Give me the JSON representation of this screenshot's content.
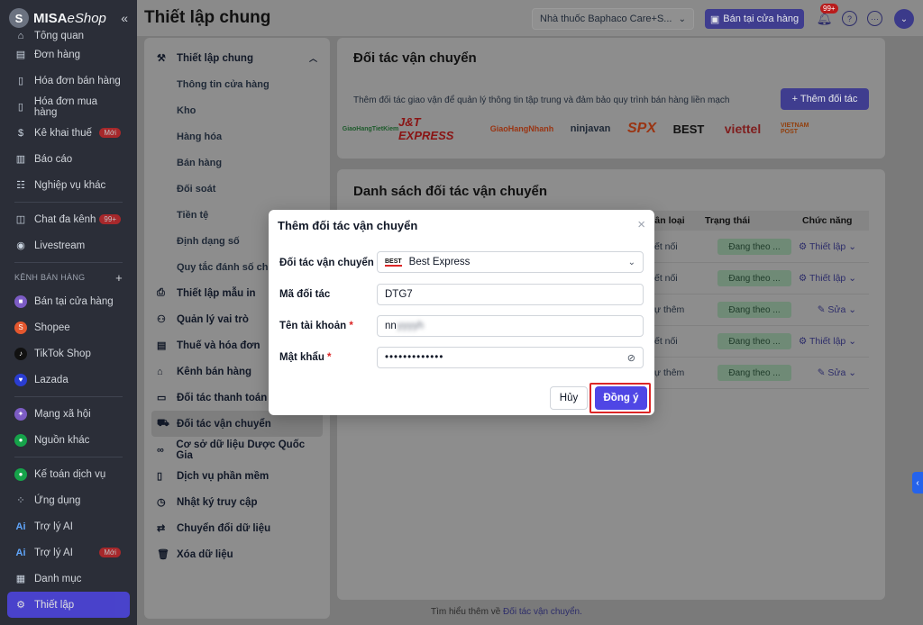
{
  "app": {
    "logo_text": "MISA",
    "logo_text2": "eShop"
  },
  "sidebar": {
    "items": [
      {
        "label": "Tổng quan",
        "icon": "home-icon"
      },
      {
        "label": "Đơn hàng",
        "icon": "order-icon"
      },
      {
        "label": "Hóa đơn bán hàng",
        "icon": "invoice-icon"
      },
      {
        "label": "Hóa đơn mua hàng",
        "icon": "purchase-invoice-icon"
      },
      {
        "label": "Kê khai thuế",
        "icon": "tax-icon",
        "badge": "Mới"
      },
      {
        "label": "Báo cáo",
        "icon": "report-icon"
      },
      {
        "label": "Nghiệp vụ khác",
        "icon": "tasks-icon"
      }
    ],
    "items2": [
      {
        "label": "Chat đa kênh",
        "icon": "chat-icon",
        "badge": "99+"
      },
      {
        "label": "Livestream",
        "icon": "livestream-icon"
      }
    ],
    "section_channels": "KÊNH BÁN HÀNG",
    "channels": [
      {
        "label": "Bán tại cửa hàng",
        "color": "#7c5cc4"
      },
      {
        "label": "Shopee",
        "color": "#e4572e"
      },
      {
        "label": "TikTok Shop",
        "color": "#111111"
      },
      {
        "label": "Lazada",
        "color": "#2a3dd1"
      }
    ],
    "items3": [
      {
        "label": "Mạng xã hội",
        "color": "#7c5cc4"
      },
      {
        "label": "Nguồn khác",
        "color": "#16a34a"
      }
    ],
    "items4": [
      {
        "label": "Kế toán dịch vụ",
        "icon": "accounting-icon"
      },
      {
        "label": "Ứng dụng",
        "icon": "apps-icon"
      },
      {
        "label": "Trợ lý AI",
        "icon": "ai-icon"
      },
      {
        "label": "Trợ lý AI",
        "icon": "ai-icon",
        "badge": "Mới"
      },
      {
        "label": "Danh mục",
        "icon": "catalog-icon"
      },
      {
        "label": "Thiết lập",
        "icon": "settings-icon"
      }
    ]
  },
  "header": {
    "title": "Thiết lập chung",
    "store_select": "Nhà thuốc Baphaco Care+S...",
    "sell_button": "Bán tại cửa hàng",
    "notif_badge": "99+"
  },
  "settings_nav": {
    "group_label": "Thiết lập chung",
    "sub_items": [
      "Thông tin cửa hàng",
      "Kho",
      "Hàng hóa",
      "Bán hàng",
      "Đối soát",
      "Tiền tệ",
      "Định dạng số",
      "Quy tắc đánh số chứ"
    ],
    "items": [
      {
        "label": "Thiết lập mẫu in",
        "icon": "print-icon"
      },
      {
        "label": "Quản lý vai trò",
        "icon": "roles-icon"
      },
      {
        "label": "Thuế và hóa đơn",
        "icon": "tax-invoice-icon"
      },
      {
        "label": "Kênh bán hàng",
        "icon": "store-icon"
      },
      {
        "label": "Đối tác thanh toán",
        "icon": "payment-icon"
      },
      {
        "label": "Đối tác vận chuyển",
        "icon": "truck-icon",
        "active": true
      },
      {
        "label": "Cơ sở dữ liệu Dược Quốc Gia",
        "icon": "link-icon"
      },
      {
        "label": "Dịch vụ phần mềm",
        "icon": "service-icon"
      },
      {
        "label": "Nhật ký truy cập",
        "icon": "history-icon"
      },
      {
        "label": "Chuyển đổi dữ liệu",
        "icon": "convert-icon"
      },
      {
        "label": "Xóa dữ liệu",
        "icon": "trash-icon"
      }
    ]
  },
  "partners_card": {
    "title": "Đối tác vận chuyển",
    "description": "Thêm đối tác giao vận để quản lý thông tin tập trung và đảm bảo quy trình bán hàng liền mạch",
    "add_button": "+ Thêm đối tác",
    "logos": [
      {
        "name": "GiaoHangTietKiem",
        "color": "#1e8a3a"
      },
      {
        "name": "J&T EXPRESS",
        "color": "#c81e1e"
      },
      {
        "name": "GiaoHangNhanh",
        "color": "#e4572e"
      },
      {
        "name": "ninjavan",
        "color": "#c81e1e"
      },
      {
        "name": "SPX",
        "color": "#e4572e"
      },
      {
        "name": "BEST",
        "color": "#111111"
      },
      {
        "name": "viettel",
        "color": "#b91c1c"
      },
      {
        "name": "VIETNAM POST",
        "color": "#d97706"
      }
    ]
  },
  "list_card": {
    "title": "Danh sách đối tác vận chuyển",
    "columns": [
      "hân loại",
      "Trạng thái",
      "Chức năng"
    ],
    "rows": [
      {
        "type": "ết nối",
        "status": "Đang theo ...",
        "action": "Thiết lập"
      },
      {
        "type": "ết nối",
        "status": "Đang theo ...",
        "action": "Thiết lập"
      },
      {
        "type": "ự thêm",
        "status": "Đang theo ...",
        "action": "Sửa"
      },
      {
        "type": "ết nối",
        "status": "Đang theo ...",
        "action": "Thiết lập"
      },
      {
        "type": "ự thêm",
        "status": "Đang theo ...",
        "action": "Sửa"
      }
    ]
  },
  "footer": {
    "text": "Tìm hiểu thêm về",
    "link": "Đối tác vận chuyển."
  },
  "modal": {
    "title": "Thêm đối tác vận chuyển",
    "fields": {
      "partner": {
        "label": "Đối tác vận chuyển",
        "value": "Best Express",
        "logo": "BEST"
      },
      "partner_code": {
        "label": "Mã đối tác",
        "value": "DTG7"
      },
      "account": {
        "label": "Tên tài khoản",
        "value": "nn",
        "masked": "yyyyh"
      },
      "password": {
        "label": "Mật khẩu",
        "value": "•••••••••••••"
      }
    },
    "cancel_button": "Hủy",
    "ok_button": "Đồng ý"
  }
}
